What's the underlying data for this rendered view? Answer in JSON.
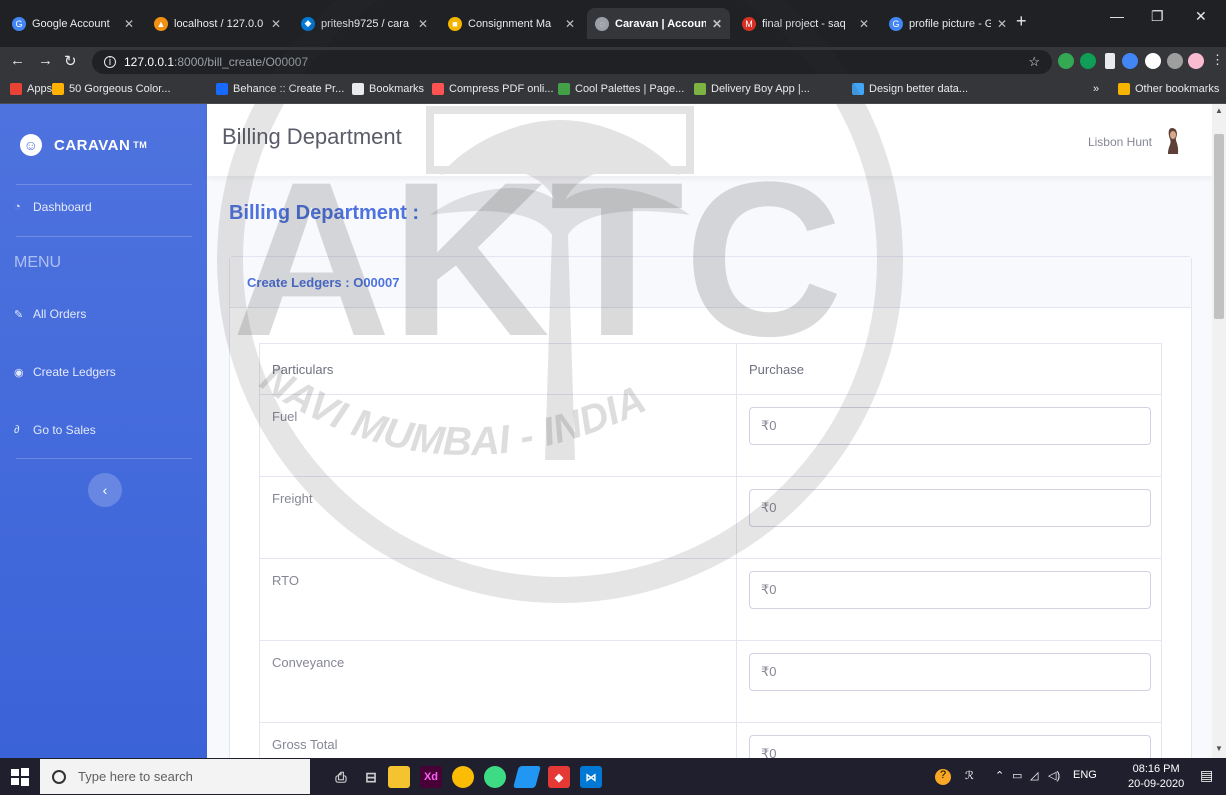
{
  "browser": {
    "tabs": [
      {
        "label": "Google Account",
        "icon": "google-icon",
        "color": "#4285f4",
        "glyph": "G"
      },
      {
        "label": "localhost / 127.0.0",
        "icon": "phpmyadmin-icon",
        "color": "#f29111",
        "glyph": "▲"
      },
      {
        "label": "pritesh9725 / cara",
        "icon": "azure-devops-icon",
        "color": "#0078d7",
        "glyph": "◆"
      },
      {
        "label": "Consignment Ma",
        "icon": "slides-icon",
        "color": "#f4b400",
        "glyph": "■"
      },
      {
        "label": "Caravan | Account",
        "icon": "caravan-icon",
        "color": "#9aa0a6",
        "glyph": "◌"
      },
      {
        "label": "final project - saq",
        "icon": "gmail-icon",
        "color": "#d93025",
        "glyph": "M"
      },
      {
        "label": "profile picture - G",
        "icon": "google-icon",
        "color": "#4285f4",
        "glyph": "G"
      }
    ],
    "url_host": "127.0.0.1",
    "url_path": ":8000/bill_create/O00007",
    "bookmarks": [
      {
        "label": "Apps",
        "icon": "apps-grid-icon",
        "color": "#ea4335"
      },
      {
        "label": "50 Gorgeous Color...",
        "icon": "palette-icon",
        "color": "#ffb300"
      },
      {
        "label": "Behance :: Create Pr...",
        "icon": "behance-icon",
        "color": "#1769ff"
      },
      {
        "label": "Bookmarks",
        "icon": "star-icon",
        "color": "#e8eaed"
      },
      {
        "label": "Compress PDF onli...",
        "icon": "heart-icon",
        "color": "#ff5252"
      },
      {
        "label": "Cool Palettes | Page...",
        "icon": "palette-bars-icon",
        "color": "#43a047"
      },
      {
        "label": "Delivery Boy App |...",
        "icon": "leaf-icon",
        "color": "#7cb342"
      },
      {
        "label": "Design better data...",
        "icon": "chart-icon",
        "color": "#42a5f5"
      }
    ],
    "other_bookmarks": "Other bookmarks"
  },
  "app": {
    "brand": "CARAVAN",
    "brand_tm": "TM",
    "sidebar": {
      "dashboard": "Dashboard",
      "menu_heading": "MENU",
      "items": [
        {
          "label": "All Orders",
          "icon": "edit-icon"
        },
        {
          "label": "Create Ledgers",
          "icon": "eye-icon"
        },
        {
          "label": "Go to Sales",
          "icon": "link-icon"
        }
      ],
      "toggle_glyph": "‹"
    },
    "topbar": {
      "title": "Billing Department",
      "user": "Lisbon Hunt"
    },
    "heading": "Billing Department :",
    "card_title": "Create Ledgers : O00007",
    "table": {
      "col_particulars": "Particulars",
      "col_purchase": "Purchase",
      "rows": [
        {
          "label": "Fuel",
          "value": "₹0"
        },
        {
          "label": "Freight",
          "value": "₹0"
        },
        {
          "label": "RTO",
          "value": "₹0"
        },
        {
          "label": "Conveyance",
          "value": "₹0"
        },
        {
          "label": "Gross Total",
          "value": "₹0"
        }
      ]
    }
  },
  "watermark": {
    "big_letters": "AKTC",
    "arc_text": "NAVI MUMBAI - INDIA"
  },
  "taskbar": {
    "search_placeholder": "Type here to search",
    "language": "ENG",
    "time": "08:16 PM",
    "date": "20-09-2020"
  }
}
